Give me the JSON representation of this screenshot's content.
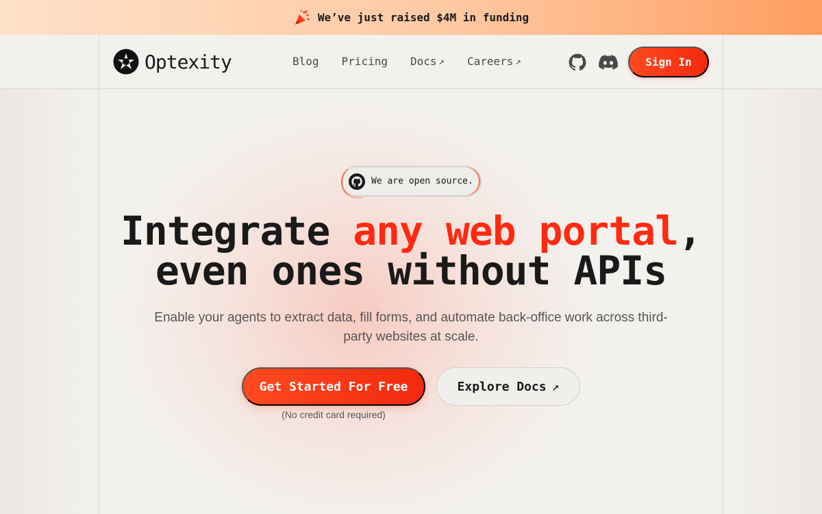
{
  "announcement": {
    "text": "We’ve just raised $4M in funding"
  },
  "brand": {
    "name": "Optexity"
  },
  "nav": {
    "links": [
      {
        "label": "Blog",
        "external": false
      },
      {
        "label": "Pricing",
        "external": false
      },
      {
        "label": "Docs",
        "external": true
      },
      {
        "label": "Careers",
        "external": true
      }
    ],
    "external_glyph": "↗",
    "icons": [
      "github-icon",
      "discord-icon"
    ],
    "signin_label": "Sign In"
  },
  "badge": {
    "text": "We are open source."
  },
  "hero": {
    "headline_part1": "Integrate ",
    "headline_accent": "any web portal",
    "headline_part2": ",",
    "headline_line2": "even ones without APIs",
    "subtitle": "Enable your agents to extract data, fill forms, and automate back-office work across third-party websites at scale.",
    "primary_cta": "Get Started For Free",
    "secondary_cta": "Explore Docs",
    "cta_note": "(No credit card required)"
  },
  "colors": {
    "accent": "#ff2a10",
    "cta": "#ff4a1f",
    "banner_end": "#ff9d60"
  }
}
